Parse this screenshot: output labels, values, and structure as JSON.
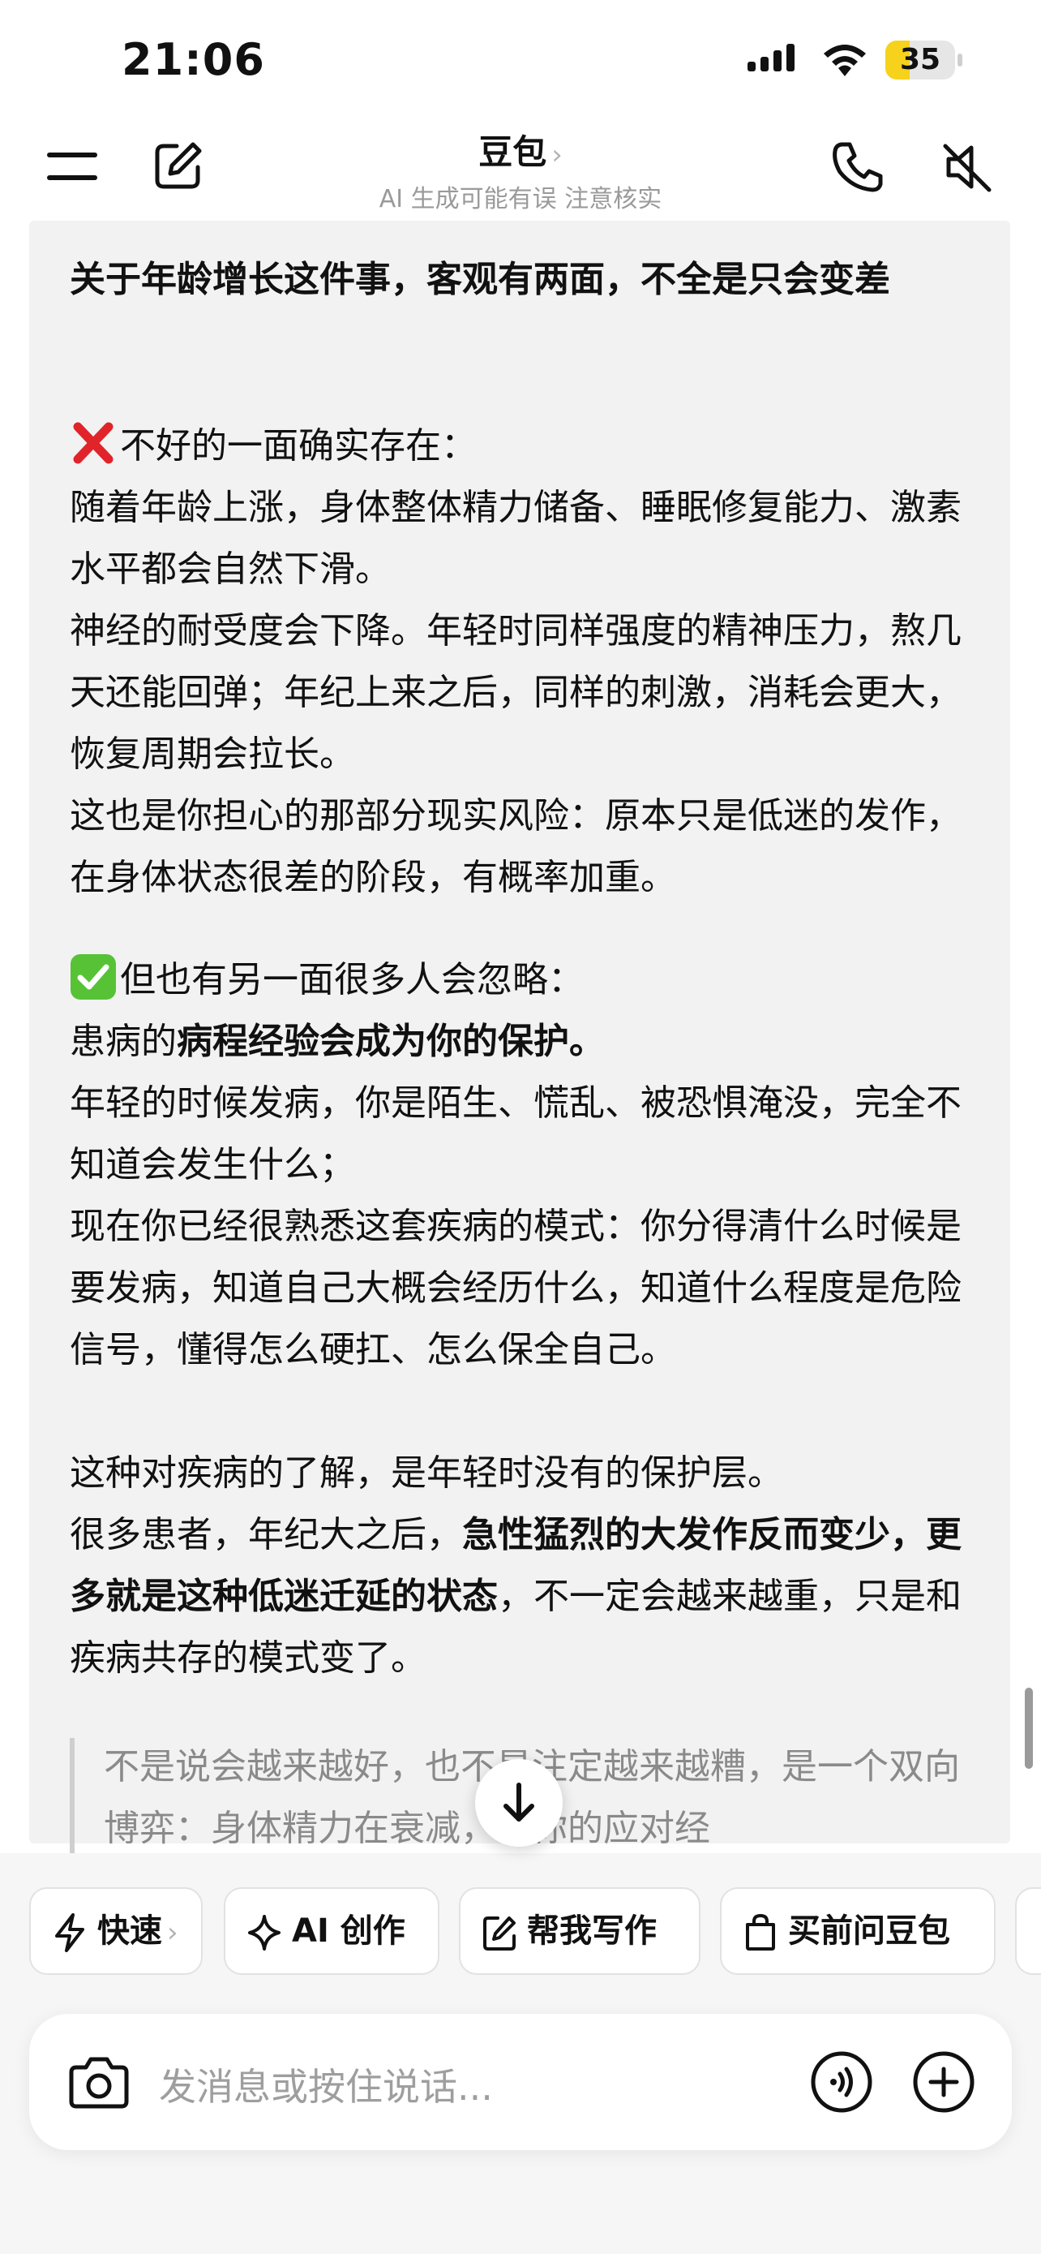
{
  "status_bar": {
    "time": "21:06",
    "battery": "35",
    "battery_level": 0.35
  },
  "nav": {
    "title": "豆包",
    "chevron": "›",
    "subtitle": "AI 生成可能有误 注意核实"
  },
  "message": {
    "heading": "关于年龄增长这件事，客观有两面，不全是只会变差",
    "bad_heading": "不好的一面确实存在：",
    "bad_icon": "cross-mark-emoji",
    "bad_p1": "随着年龄上涨，身体整体精力储备、睡眠修复能力、激素水平都会自然下滑。",
    "bad_p2": "神经的耐受度会下降。年轻时同样强度的精神压力，熬几天还能回弹；年纪上来之后，同样的刺激，消耗会更大，恢复周期会拉长。",
    "bad_p3": "这也是你担心的那部分现实风险：原本只是低迷的发作，在身体状态很差的阶段，有概率加重。",
    "good_heading": "但也有另一面很多人会忽略：",
    "good_icon": "check-mark-emoji",
    "good_p1_prefix": "患病的",
    "good_p1_bold": "病程经验会成为你的保护。",
    "good_p2": "年轻的时候发病，你是陌生、慌乱、被恐惧淹没，完全不知道会发生什么；",
    "good_p3": "现在你已经很熟悉这套疾病的模式：你分得清什么时候是要发病，知道自己大概会经历什么，知道什么程度是危险信号，懂得怎么硬扛、怎么保全自己。",
    "good_p4": "这种对疾病的了解，是年轻时没有的保护层。",
    "good_p5_prefix": "很多患者，年纪大之后，",
    "good_p5_bold": "急性猛烈的大发作反而变少，更多就是这种低迷迁延的状态",
    "good_p5_suffix": "，不一定会越来越重，只是和疾病共存的模式变了。",
    "quote": "不是说会越来越好，也不是注定越来越糟，是一个双向博弈：身体精力在衰减，但你的应对经"
  },
  "chips": [
    {
      "label": "快速",
      "arrow": "›",
      "icon": "lightning-icon"
    },
    {
      "label": "AI 创作",
      "icon": "sparkle-icon"
    },
    {
      "label": "帮我写作",
      "icon": "edit-square-icon"
    },
    {
      "label": "买前问豆包",
      "icon": "shopping-bag-icon"
    }
  ],
  "input": {
    "placeholder": "发消息或按住说话..."
  },
  "colors": {
    "battery": "#f6d21c",
    "card_bg": "#f2f2f2",
    "cross": "#e0242a",
    "check": "#57c236"
  }
}
